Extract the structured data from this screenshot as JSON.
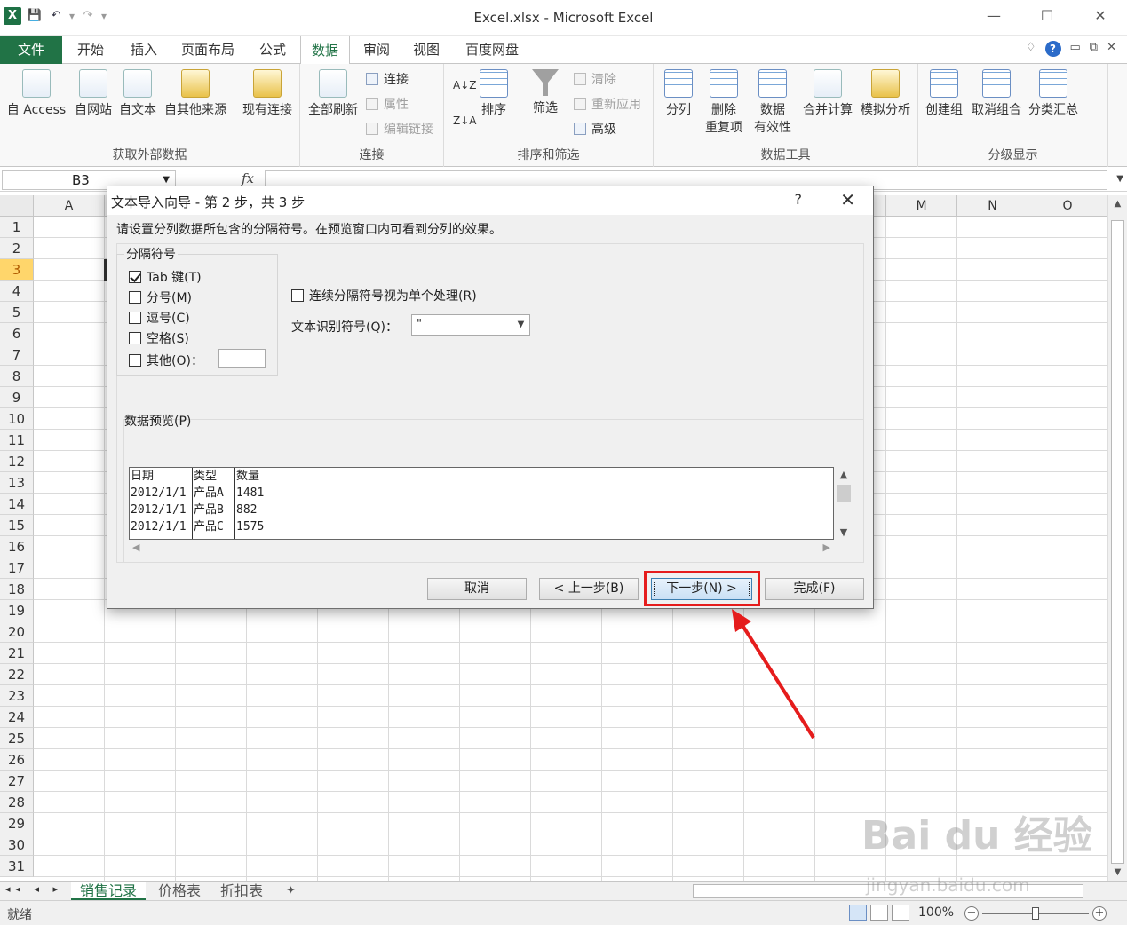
{
  "window": {
    "title": "Excel.xlsx - Microsoft Excel",
    "controls": [
      "—",
      "☐",
      "✕"
    ]
  },
  "qat": {
    "app_icon": "X",
    "save": "💾",
    "undo": "↶",
    "redo": "↷",
    "dropdown": "▾"
  },
  "tabs": {
    "file": "文件",
    "items": [
      "开始",
      "插入",
      "页面布局",
      "公式",
      "数据",
      "审阅",
      "视图",
      "百度网盘"
    ],
    "active": "数据",
    "right_icons": [
      "♢",
      "?",
      "▭",
      "⧉",
      "✕"
    ]
  },
  "ribbon": {
    "external": {
      "buttons": [
        "自 Access",
        "自网站",
        "自文本",
        "自其他来源",
        "现有连接"
      ],
      "label": "获取外部数据"
    },
    "connections": {
      "refresh": "全部刷新",
      "connect": "连接",
      "properties": "属性",
      "edit_links": "编辑链接",
      "label": "连接"
    },
    "sort_filter": {
      "sort": "排序",
      "filter": "筛选",
      "clear": "清除",
      "reapply": "重新应用",
      "advanced": "高级",
      "label": "排序和筛选",
      "az": "A↓Z",
      "za": "Z↓A"
    },
    "data_tools": {
      "split": "分列",
      "remove_dup_1": "删除",
      "remove_dup_2": "重复项",
      "validation_1": "数据",
      "validation_2": "有效性",
      "consolidate": "合并计算",
      "whatif": "模拟分析",
      "label": "数据工具"
    },
    "outline": {
      "group": "创建组",
      "ungroup": "取消组合",
      "subtotal": "分类汇总",
      "label": "分级显示"
    }
  },
  "formula_bar": {
    "name_box": "B3",
    "fx": "fx"
  },
  "grid": {
    "columns": [
      "A",
      "M",
      "N",
      "O"
    ],
    "rows": [
      "1",
      "2",
      "3",
      "4",
      "5",
      "6",
      "7",
      "8",
      "9",
      "10",
      "11",
      "12",
      "13",
      "14",
      "15",
      "16",
      "17",
      "18",
      "19",
      "20",
      "21",
      "22",
      "23",
      "24",
      "25",
      "26",
      "27",
      "28",
      "29",
      "30",
      "31"
    ],
    "selected_row": "3"
  },
  "sheets": {
    "tabs": [
      "销售记录",
      "价格表",
      "折扣表"
    ],
    "active": "销售记录",
    "nav": "◂◂ ◂ ▸ ▸▸"
  },
  "status": {
    "ready": "就绪",
    "zoom": "100%"
  },
  "dialog": {
    "title": "文本导入向导 - 第 2 步，共 3 步",
    "help": "?",
    "close": "✕",
    "instruction": "请设置分列数据所包含的分隔符号。在预览窗口内可看到分列的效果。",
    "delimiters_label": "分隔符号",
    "delimiters": [
      {
        "label": "Tab 键(T)",
        "checked": true
      },
      {
        "label": "分号(M)",
        "checked": false
      },
      {
        "label": "逗号(C)",
        "checked": false
      },
      {
        "label": "空格(S)",
        "checked": false
      },
      {
        "label": "其他(O)：",
        "checked": false
      }
    ],
    "consecutive": "连续分隔符号视为单个处理(R)",
    "qualifier_label": "文本识别符号(Q)：",
    "qualifier_value": "\"",
    "preview_label": "数据预览(P)",
    "preview": {
      "rows": [
        [
          "日期",
          "类型",
          "数量"
        ],
        [
          "2012/1/1",
          "产品A",
          "1481"
        ],
        [
          "2012/1/1",
          "产品B",
          "882"
        ],
        [
          "2012/1/1",
          "产品C",
          "1575"
        ]
      ]
    },
    "buttons": {
      "cancel": "取消",
      "back": "< 上一步(B)",
      "next": "下一步(N) >",
      "finish": "完成(F)"
    }
  },
  "annotation": {
    "highlight_color": "#e51c1c"
  },
  "watermark": {
    "main": "Bai du 经验",
    "sub": "jingyan.baidu.com"
  },
  "colors": {
    "excel_green": "#217346",
    "accent_blue": "#3c7fb1"
  }
}
